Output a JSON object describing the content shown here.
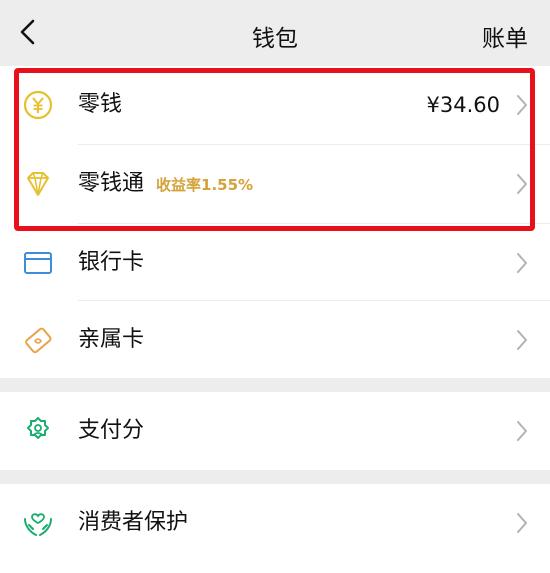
{
  "header": {
    "title": "钱包",
    "bill_label": "账单"
  },
  "group1": {
    "items": [
      {
        "label": "零钱",
        "value": "¥34.60",
        "icon": "yuan-coin-icon"
      },
      {
        "label": "零钱通",
        "sub": "收益率1.55%",
        "icon": "diamond-icon"
      },
      {
        "label": "银行卡",
        "icon": "bank-card-icon"
      },
      {
        "label": "亲属卡",
        "icon": "family-card-icon"
      }
    ]
  },
  "group2": {
    "items": [
      {
        "label": "支付分",
        "icon": "pay-score-icon"
      }
    ]
  },
  "group3": {
    "items": [
      {
        "label": "消费者保护",
        "icon": "consumer-protection-icon"
      }
    ]
  },
  "colors": {
    "background": "#ededed",
    "highlight": "#e8101a",
    "gold": "#e6c12e",
    "green": "#1aad6e",
    "blue": "#3b8ed9",
    "orange": "#e8a24a",
    "rate_text": "#d5a13a"
  }
}
